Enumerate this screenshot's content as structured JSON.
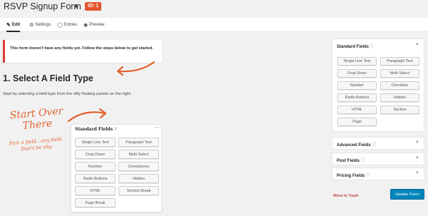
{
  "header": {
    "form_title": "RSVP Signup Form",
    "id_badge": "ID: 1"
  },
  "tabs": [
    {
      "label": "Edit",
      "icon": "edit-icon",
      "active": true
    },
    {
      "label": "Settings",
      "icon": "gear-icon",
      "active": false
    },
    {
      "label": "Entries",
      "icon": "comment-icon",
      "active": false
    },
    {
      "label": "Preview",
      "icon": "eye-icon",
      "active": false
    }
  ],
  "notice": {
    "text": "This form doesn't have any fields yet. Follow the steps below to get started."
  },
  "step": {
    "title": "1. Select A Field Type",
    "description": "Start by selecting a field type from the nifty floating panels on the right."
  },
  "handwritten": {
    "big": "Start Over There",
    "small": "Pick a field.. any field. Don't be shy."
  },
  "inline_panel": {
    "title": "Standard Fields",
    "fields": [
      "Single Line Text",
      "Paragraph Text",
      "Drop Down",
      "Multi Select",
      "Number",
      "Checkboxes",
      "Radio Buttons",
      "Hidden",
      "HTML",
      "Section Break",
      "Page Break"
    ]
  },
  "sidebar": {
    "standard": {
      "title": "Standard Fields",
      "fields": [
        "Single Line Text",
        "Paragraph Text",
        "Drop Down",
        "Multi Select",
        "Number",
        "Checkbox",
        "Radio Buttons",
        "Hidden",
        "HTML",
        "Section",
        "Page"
      ]
    },
    "advanced_title": "Advanced Fields",
    "post_title": "Post Fields",
    "pricing_title": "Pricing Fields"
  },
  "actions": {
    "trash_label": "Move to Trash",
    "update_label": "Update Form"
  },
  "colors": {
    "accent_orange": "#e2622c",
    "badge": "#e2542c",
    "notice_border": "#dd3d36",
    "primary_button": "#0085ba",
    "trash_link": "#aa0000"
  }
}
